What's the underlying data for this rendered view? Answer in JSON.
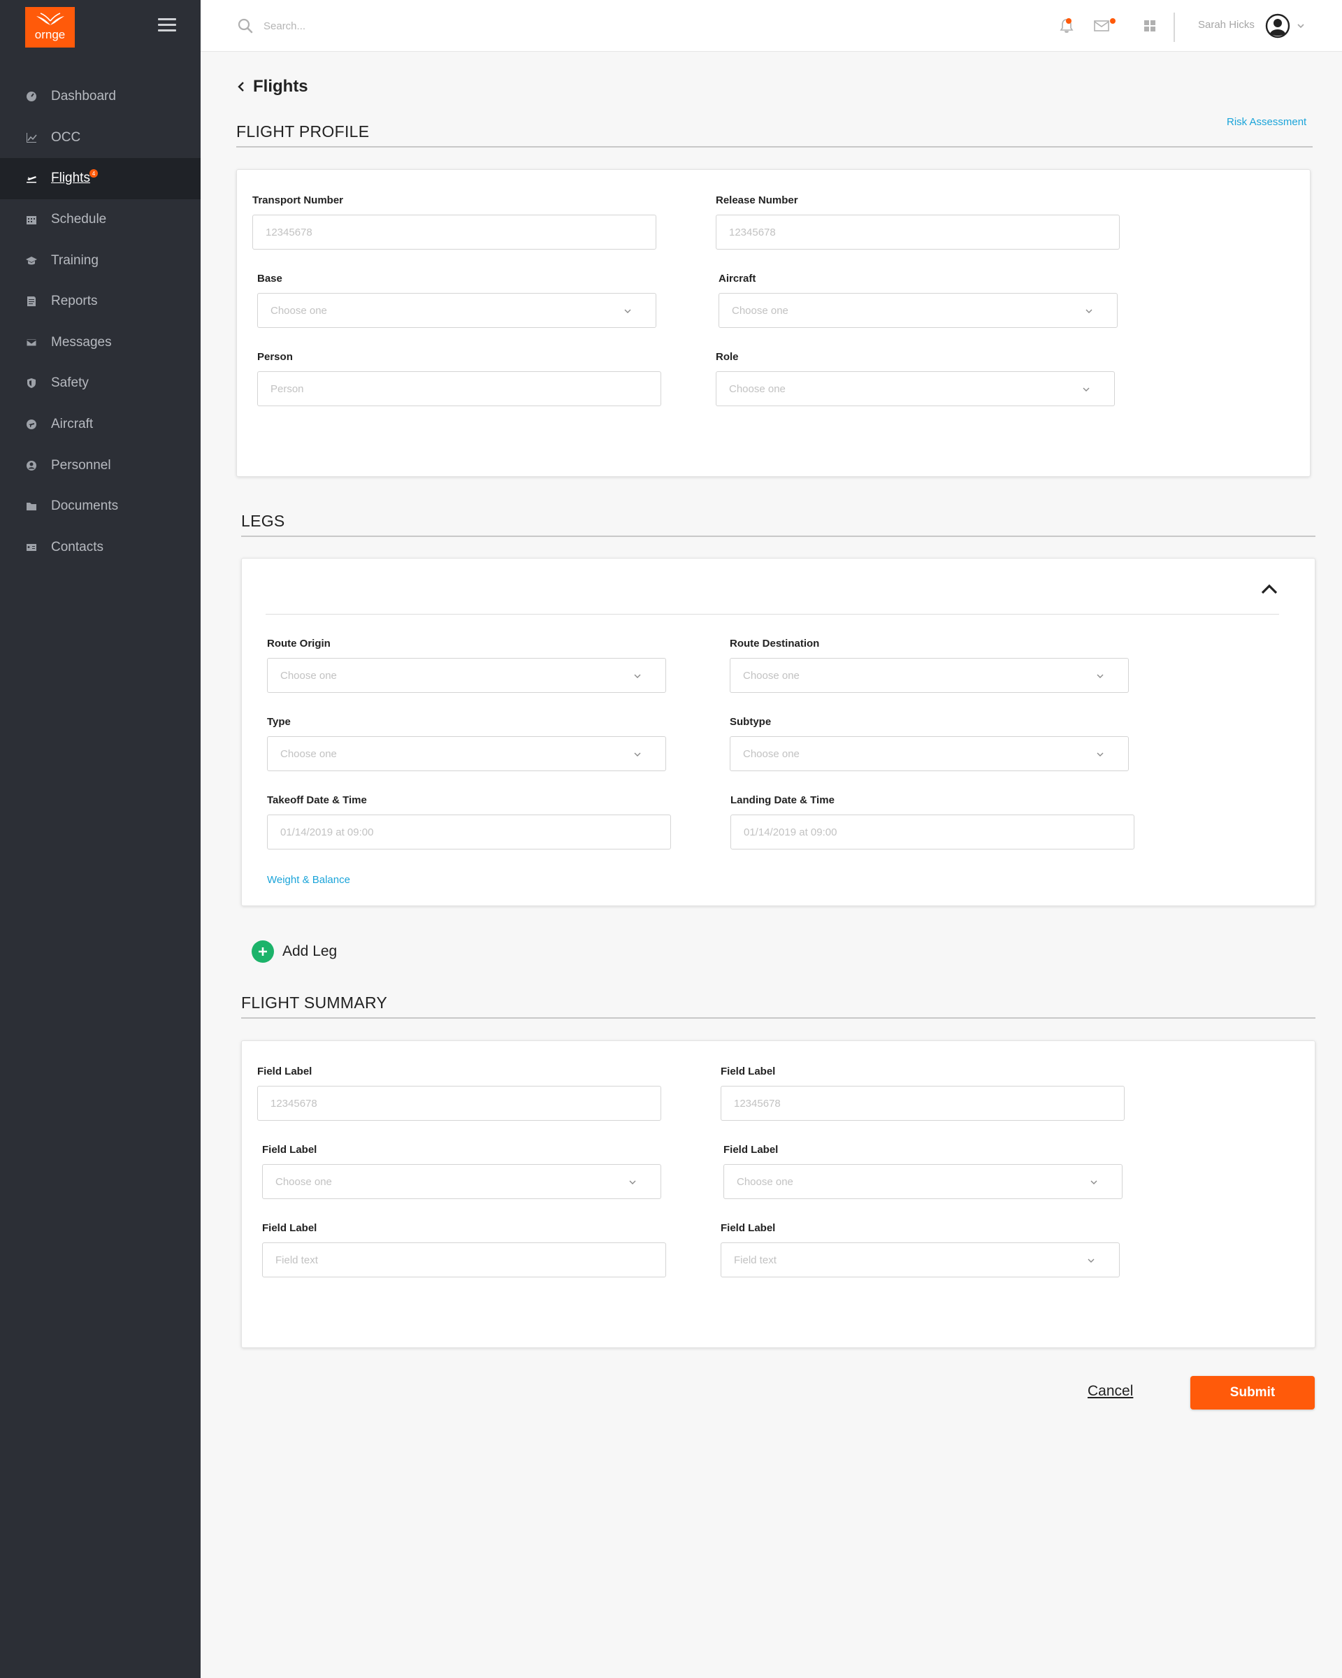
{
  "brand": {
    "logo_text": "ornge",
    "accent_color": "#ff5a0a"
  },
  "sidebar": {
    "items": [
      {
        "label": "Dashboard",
        "icon": "dashboard-icon"
      },
      {
        "label": "OCC",
        "icon": "chart-icon"
      },
      {
        "label": "Flights",
        "icon": "plane-icon",
        "active": true,
        "badge": "4"
      },
      {
        "label": "Schedule",
        "icon": "calendar-icon"
      },
      {
        "label": "Training",
        "icon": "graduation-cap-icon"
      },
      {
        "label": "Reports",
        "icon": "report-icon"
      },
      {
        "label": "Messages",
        "icon": "envelope-icon"
      },
      {
        "label": "Safety",
        "icon": "shield-icon"
      },
      {
        "label": "Aircraft",
        "icon": "aircraft-icon"
      },
      {
        "label": "Personnel",
        "icon": "person-circle-icon"
      },
      {
        "label": "Documents",
        "icon": "folder-icon"
      },
      {
        "label": "Contacts",
        "icon": "contact-card-icon"
      }
    ]
  },
  "topbar": {
    "search_placeholder": "Search...",
    "user_name": "Sarah Hicks"
  },
  "page": {
    "title": "Flights",
    "risk_link": "Risk Assessment"
  },
  "flight_profile": {
    "title": "FLIGHT PROFILE",
    "transport_label": "Transport Number",
    "transport_placeholder": "12345678",
    "release_label": "Release Number",
    "release_placeholder": "12345678",
    "base_label": "Base",
    "base_value": "Choose one",
    "aircraft_label": "Aircraft",
    "aircraft_value": "Choose one",
    "person_label": "Person",
    "person_placeholder": "Person",
    "role_label": "Role",
    "role_value": "Choose one"
  },
  "legs": {
    "title": "LEGS",
    "origin_label": "Route Origin",
    "origin_value": "Choose one",
    "destination_label": "Route Destination",
    "destination_value": "Choose one",
    "type_label": "Type",
    "type_value": "Choose one",
    "subtype_label": "Subtype",
    "subtype_value": "Choose one",
    "takeoff_label": "Takeoff Date & Time",
    "takeoff_placeholder": "01/14/2019 at 09:00",
    "landing_label": "Landing Date & Time",
    "landing_placeholder": "01/14/2019 at 09:00",
    "weight_link": "Weight & Balance",
    "add_leg": "Add Leg"
  },
  "summary": {
    "title": "FLIGHT SUMMARY",
    "f1_label": "Field Label",
    "f1_placeholder": "12345678",
    "f2_label": "Field Label",
    "f2_placeholder": "12345678",
    "f3_label": "Field Label",
    "f3_value": "Choose one",
    "f4_label": "Field Label",
    "f4_value": "Choose one",
    "f5_label": "Field Label",
    "f5_placeholder": "Field text",
    "f6_label": "Field Label",
    "f6_value": "Field text"
  },
  "actions": {
    "cancel": "Cancel",
    "submit": "Submit"
  }
}
